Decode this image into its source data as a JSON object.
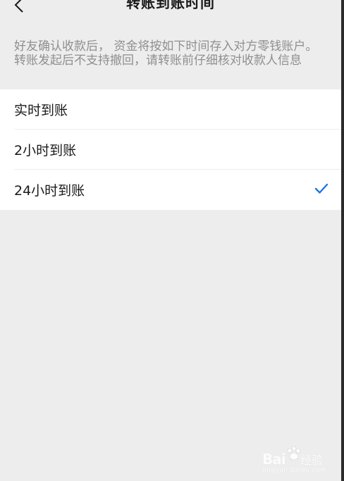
{
  "nav": {
    "title": "转账到账时间",
    "back_icon": "chevron-left-icon"
  },
  "description": "好友确认收款后， 资金将按如下时间存入对方零钱账户。转账发起后不支持撤回，请转账前仔细核对收款人信息",
  "options": [
    {
      "label": "实时到账",
      "selected": false
    },
    {
      "label": "2小时到账",
      "selected": false
    },
    {
      "label": "24小时到账",
      "selected": true
    }
  ],
  "colors": {
    "accent": "#1f74ea",
    "background": "#ededed",
    "card": "#ffffff",
    "secondary_text": "#8f8f8f"
  },
  "watermark": {
    "brand": "Bai",
    "suffix": "经验",
    "url": "jingyan.baidu.com"
  }
}
